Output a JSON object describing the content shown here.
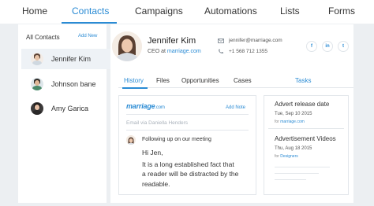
{
  "nav": {
    "items": [
      {
        "label": "Home"
      },
      {
        "label": "Contacts"
      },
      {
        "label": "Campaigns"
      },
      {
        "label": "Automations"
      },
      {
        "label": "Lists"
      },
      {
        "label": "Forms"
      }
    ],
    "active_index": 1
  },
  "sidebar": {
    "title": "All Contacts",
    "add_label": "Add New",
    "contacts": [
      {
        "name": "Jennifer Kim",
        "selected": true
      },
      {
        "name": "Johnson bane",
        "selected": false
      },
      {
        "name": "Amy Garica",
        "selected": false
      }
    ]
  },
  "profile": {
    "name": "Jennifer Kim",
    "title_prefix": "CEO at",
    "company": "marriage.com",
    "email": "jennifer@marriage.com",
    "phone": "+1 568 712 1355",
    "social": [
      {
        "icon": "facebook-icon",
        "glyph": "f"
      },
      {
        "icon": "linkedin-icon",
        "glyph": "in"
      },
      {
        "icon": "twitter-icon",
        "glyph": "t"
      }
    ]
  },
  "tabs": {
    "items": [
      {
        "label": "History"
      },
      {
        "label": "Files"
      },
      {
        "label": "Opportunities"
      },
      {
        "label": "Cases"
      }
    ],
    "tasks_label": "Tasks"
  },
  "note": {
    "brand": "marriage",
    "brand_suffix": ".com",
    "add_note_label": "Add Note",
    "email_via": "Email via Daniella Henders",
    "subject": "Following up on our meeting",
    "body": [
      "Hi Jen,",
      "It is a long established fact that",
      "a reader will be distracted by the",
      "readable."
    ]
  },
  "tasks": [
    {
      "title": "Advert release date",
      "date": "Tue, Sep 10 2015",
      "for_prefix": "for",
      "for_target": "marriage.com"
    },
    {
      "title": "Advertisement Videos",
      "date": "Thu, Aug 18 2015",
      "for_prefix": "for",
      "for_target": "Designers"
    }
  ],
  "colors": {
    "accent": "#2a8bd4",
    "background": "#eceff2"
  }
}
